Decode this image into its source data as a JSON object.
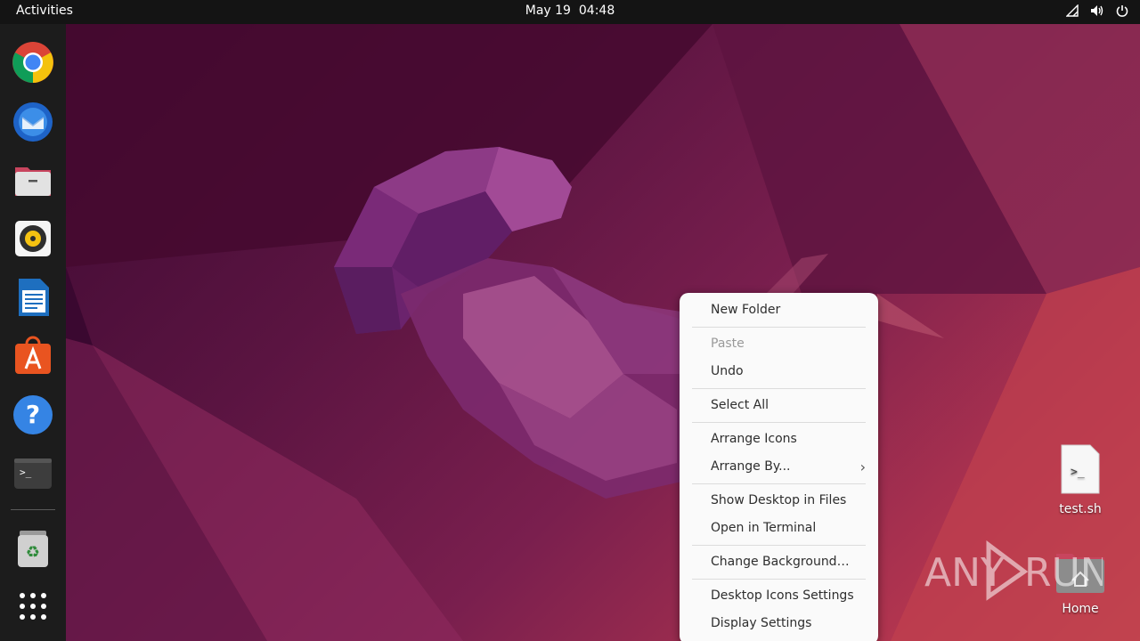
{
  "topbar": {
    "activities": "Activities",
    "date": "May 19",
    "time": "04:48",
    "tray_icons": [
      "network-icon",
      "volume-icon",
      "power-icon"
    ]
  },
  "dock": {
    "items": [
      {
        "name": "chrome",
        "icon": "chrome-icon"
      },
      {
        "name": "thunderbird",
        "icon": "thunderbird-icon"
      },
      {
        "name": "files",
        "icon": "files-icon"
      },
      {
        "name": "rhythmbox",
        "icon": "rhythmbox-icon"
      },
      {
        "name": "libreoffice-writer",
        "icon": "writer-icon"
      },
      {
        "name": "software",
        "icon": "software-icon"
      },
      {
        "name": "help",
        "icon": "help-icon"
      },
      {
        "name": "terminal",
        "icon": "terminal-icon"
      },
      {
        "name": "trash",
        "icon": "trash-icon"
      },
      {
        "name": "show-apps",
        "icon": "app-grid-icon"
      }
    ]
  },
  "context_menu": {
    "new_folder": "New Folder",
    "paste": "Paste",
    "undo": "Undo",
    "select_all": "Select All",
    "arrange_icons": "Arrange Icons",
    "arrange_by": "Arrange By...",
    "show_desktop_in_files": "Show Desktop in Files",
    "open_in_terminal": "Open in Terminal",
    "change_background": "Change Background…",
    "desktop_icons_settings": "Desktop Icons Settings",
    "display_settings": "Display Settings"
  },
  "desktop": {
    "file_label": "test.sh",
    "file_glyph": ">_",
    "home_label": "Home"
  },
  "watermark": {
    "text_left": "ANY",
    "text_right": "RUN"
  },
  "colors": {
    "topbar": "#141414",
    "dock": "#1c1c1c",
    "menu_bg": "#fafafa",
    "wallpaper_dark": "#3a0830",
    "wallpaper_light": "#c44a4e"
  }
}
